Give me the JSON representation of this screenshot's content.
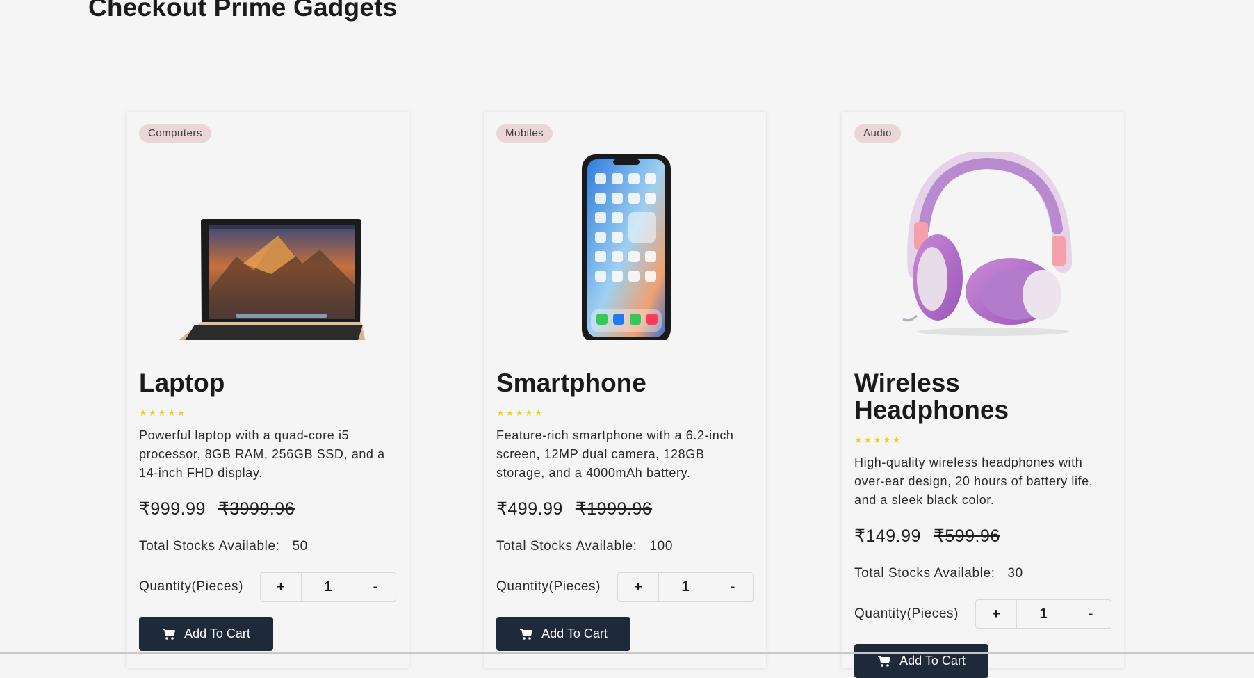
{
  "page": {
    "title": "Checkout Prime Gadgets"
  },
  "colors": {
    "background": "#f5f5f5",
    "badge_bg": "#ead6d6",
    "button_bg": "#1e2a3a",
    "star": "#ecd21d"
  },
  "labels": {
    "stock_label": "Total Stocks Available:",
    "quantity_label": "Quantity(Pieces)",
    "add_to_cart": "Add To Cart",
    "plus": "+",
    "minus": "-"
  },
  "products": [
    {
      "category": "Computers",
      "name": "Laptop",
      "rating_text": "★★★★★",
      "rating": 5,
      "description": "Powerful laptop with a quad-core i5 processor, 8GB RAM, 256GB SSD, and a 14-inch FHD display.",
      "price": "₹999.99",
      "original_price": "₹3999.96",
      "stock": "50",
      "quantity": "1",
      "image_icon": "laptop-image"
    },
    {
      "category": "Mobiles",
      "name": "Smartphone",
      "rating_text": "★★★★★",
      "rating": 5,
      "description": "Feature-rich smartphone with a 6.2-inch screen, 12MP dual camera, 128GB storage, and a 4000mAh battery.",
      "price": "₹499.99",
      "original_price": "₹1999.96",
      "stock": "100",
      "quantity": "1",
      "image_icon": "smartphone-image"
    },
    {
      "category": "Audio",
      "name": "Wireless Headphones",
      "rating_text": "★★★★★",
      "rating": 5,
      "description": "High-quality wireless headphones with over-ear design, 20 hours of battery life, and a sleek black color.",
      "price": "₹149.99",
      "original_price": "₹599.96",
      "stock": "30",
      "quantity": "1",
      "image_icon": "headphones-image"
    }
  ]
}
